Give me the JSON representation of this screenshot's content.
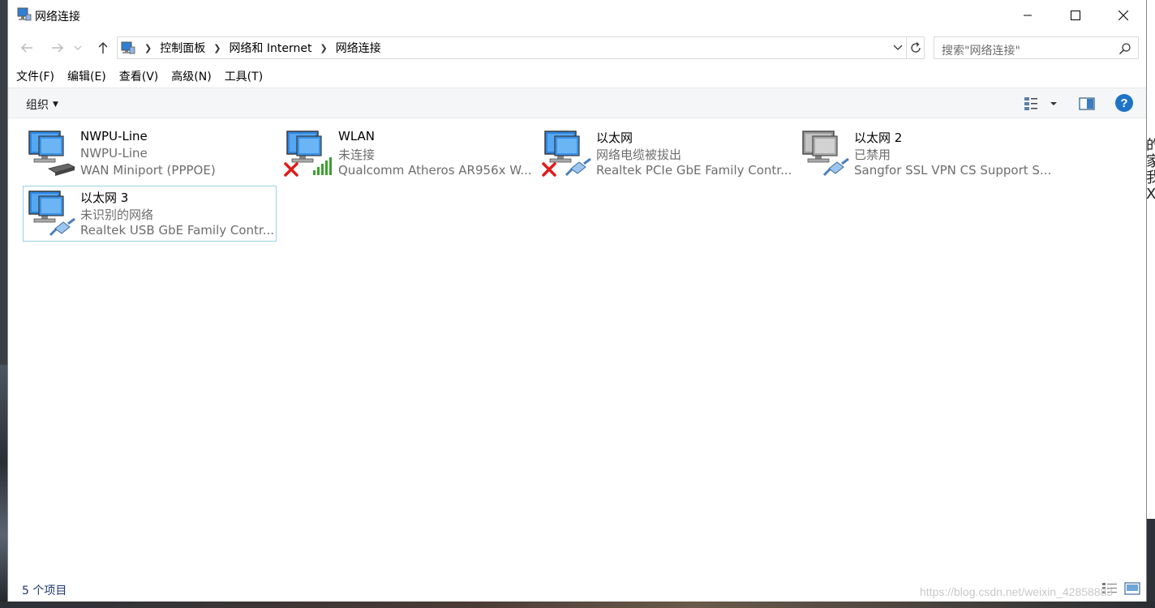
{
  "window": {
    "title": "网络连接"
  },
  "nav": {
    "back_icon": "back-arrow-icon",
    "forward_icon": "forward-arrow-icon",
    "up_icon": "up-arrow-icon"
  },
  "breadcrumb": [
    "控制面板",
    "网络和 Internet",
    "网络连接"
  ],
  "search": {
    "placeholder": "搜索\"网络连接\""
  },
  "menu": [
    "文件(F)",
    "编辑(E)",
    "查看(V)",
    "高级(N)",
    "工具(T)"
  ],
  "toolbar": {
    "organize": "组织",
    "help_icon": "?"
  },
  "connections": [
    {
      "name": "NWPU-Line",
      "status": "NWPU-Line",
      "device": "WAN Miniport (PPPOE)",
      "kind": "wan",
      "badge": ""
    },
    {
      "name": "WLAN",
      "status": "未连接",
      "device": "Qualcomm Atheros AR956x W...",
      "kind": "wifi",
      "badge": "x"
    },
    {
      "name": "以太网",
      "status": "网络电缆被拔出",
      "device": "Realtek PCIe GbE Family Contr...",
      "kind": "ethernet",
      "badge": "x"
    },
    {
      "name": "以太网 2",
      "status": "已禁用",
      "device": "Sangfor SSL VPN CS Support S...",
      "kind": "ethernet-disabled",
      "badge": ""
    },
    {
      "name": "以太网 3",
      "status": "未识别的网络",
      "device": "Realtek USB GbE Family Contr...",
      "kind": "ethernet",
      "badge": "",
      "selected": true
    }
  ],
  "statusbar": {
    "count": "5 个项目"
  },
  "watermark": "https://blog.csdn.net/weixin_42858883",
  "colors": {
    "accent": "#0078d7",
    "selection_border": "#99d1e5",
    "help": "#1e73c8",
    "error_red": "#e01b1b",
    "signal_green": "#3aa130"
  }
}
